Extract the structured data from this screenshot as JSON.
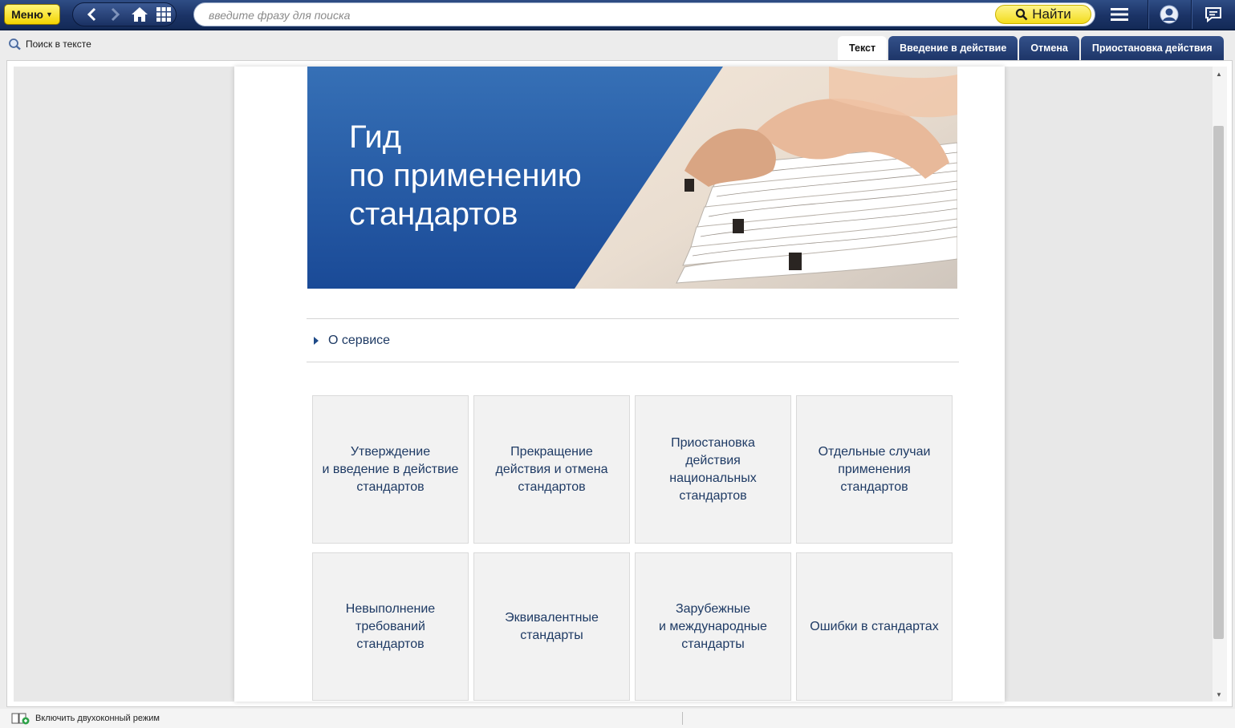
{
  "topbar": {
    "menu_label": "Меню",
    "search_placeholder": "введите фразу для поиска",
    "find_label": "Найти",
    "icons": [
      "back-arrow",
      "forward-arrow",
      "home",
      "grid",
      "hamburger",
      "user",
      "chat"
    ]
  },
  "toolbar": {
    "search_in_text": "Поиск в тексте"
  },
  "tabs": [
    {
      "label": "Текст",
      "active": true
    },
    {
      "label": "Введение в действие",
      "active": false
    },
    {
      "label": "Отмена",
      "active": false
    },
    {
      "label": "Приостановка действия",
      "active": false
    }
  ],
  "document": {
    "banner_title": "Гид\nпо применению\nстандартов",
    "about_label": "О сервисе",
    "cards": [
      "Утверждение\nи введение в действие\nстандартов",
      "Прекращение\nдействия и отмена\nстандартов",
      "Приостановка\nдействия\nнациональных\nстандартов",
      "Отдельные случаи\nприменения\nстандартов",
      "Невыполнение\nтребований\nстандартов",
      "Эквивалентные\nстандарты",
      "Зарубежные\nи международные\nстандарты",
      "Ошибки в стандартах"
    ]
  },
  "statusbar": {
    "dual_mode_label": "Включить двухоконный режим"
  },
  "colors": {
    "topbar": "#1b3366",
    "accent_yellow": "#f3d400",
    "banner_blue": "#1b4c99",
    "card_text": "#1e3a64",
    "card_bg": "#f2f2f2"
  }
}
